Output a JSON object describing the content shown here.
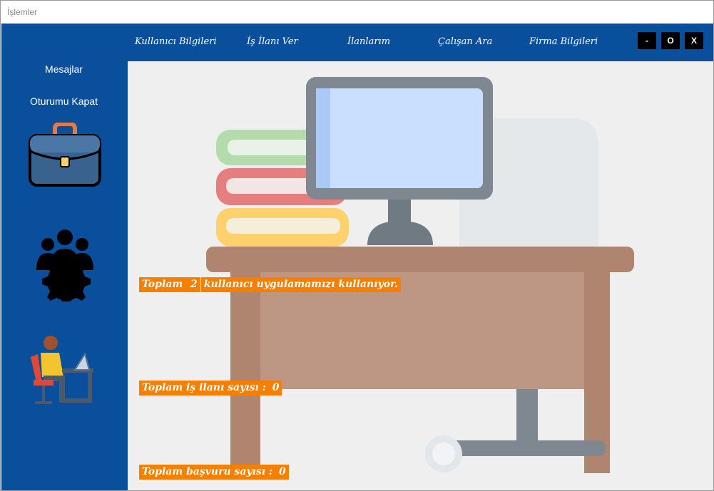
{
  "window": {
    "title": "İşlemler"
  },
  "nav": {
    "items": [
      {
        "id": "kullanici",
        "label": "Kullanıcı Bilgileri"
      },
      {
        "id": "is-ilani",
        "label": "İş İlanı Ver"
      },
      {
        "id": "ilanlarim",
        "label": "İlanlarım"
      },
      {
        "id": "calisan",
        "label": "Çalışan Ara"
      },
      {
        "id": "firma",
        "label": "Firma Bilgileri"
      }
    ]
  },
  "window_controls": {
    "minimize": "-",
    "maximize": "O",
    "close": "X"
  },
  "sidebar": {
    "messages": "Mesajlar",
    "logout": "Oturumu Kapat",
    "icons": [
      "briefcase-icon",
      "team-gear-icon",
      "person-at-desk-icon"
    ]
  },
  "stats": {
    "users_prefix": "Toplam",
    "users_count": "2",
    "users_suffix": "kullanıcı uygulamamızı kullanıyor.",
    "jobs_label": "Toplam iş ilanı sayısı :",
    "jobs_count": "0",
    "applications_label": "Toplam başvuru sayısı :",
    "applications_count": "0"
  },
  "colors": {
    "primary": "#0a4f9c",
    "accent": "#f47f00",
    "content_bg": "#efefef"
  }
}
